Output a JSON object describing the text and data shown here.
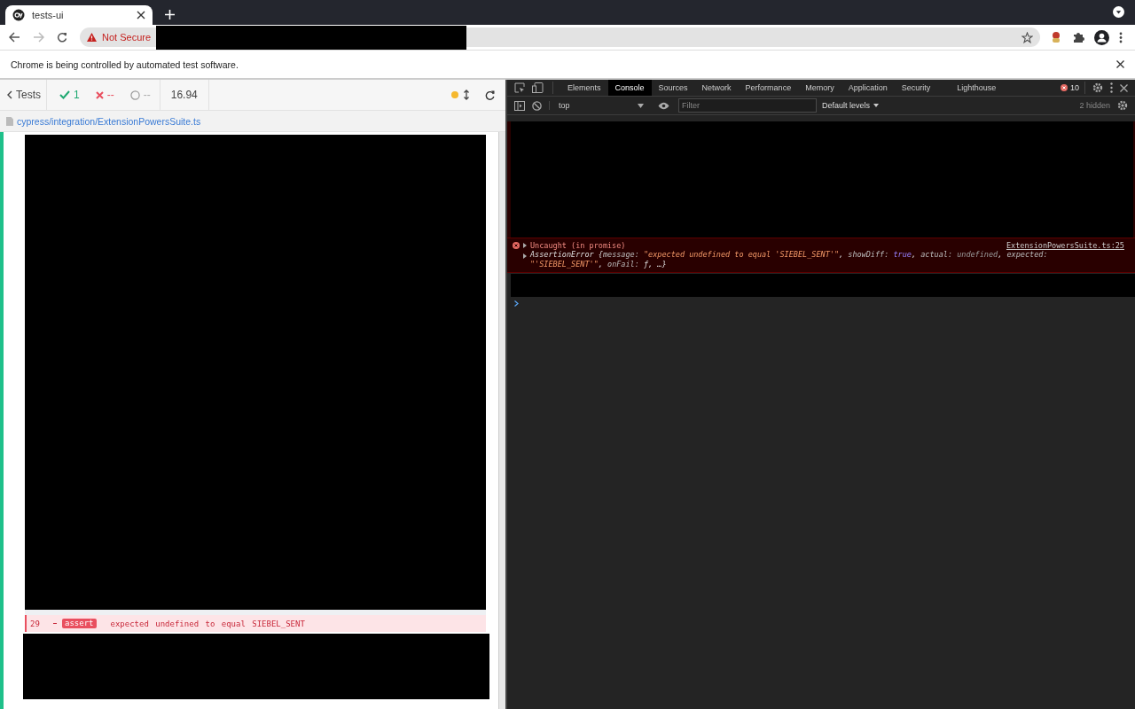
{
  "browser": {
    "tab_title": "tests-ui",
    "url_warning": "Not Secure",
    "infobar": "Chrome is being controlled by automated test software."
  },
  "runner": {
    "back_label": "Tests",
    "passed": "1",
    "failed": "--",
    "pending": "--",
    "duration": "16.94",
    "spec_path": "cypress/integration/ExtensionPowersSuite.ts",
    "command_log": [
      {
        "number": "29",
        "failed": true,
        "label": "assert",
        "message": "expected undefined to equal SIEBEL_SENT"
      }
    ]
  },
  "devtools": {
    "tabs": [
      {
        "label": "Elements",
        "selected": false
      },
      {
        "label": "Console",
        "selected": true
      },
      {
        "label": "Sources",
        "selected": false
      },
      {
        "label": "Network",
        "selected": false
      },
      {
        "label": "Performance",
        "selected": false
      },
      {
        "label": "Memory",
        "selected": false
      },
      {
        "label": "Application",
        "selected": false
      },
      {
        "label": "Security",
        "selected": false
      },
      {
        "label": "Lighthouse",
        "selected": false
      }
    ],
    "error_count": "10",
    "context": "top",
    "filter_placeholder": "Filter",
    "levels": "Default levels",
    "hidden": "2 hidden",
    "messages": [
      {
        "error": true,
        "summary": "Uncaught (in promise)",
        "source": "ExtensionPowersSuite.ts:25",
        "detail": [
          {
            "kind": "plain",
            "text": "AssertionError {"
          },
          {
            "kind": "key",
            "text": "message: "
          },
          {
            "kind": "string",
            "text": "\"expected undefined to equal 'SIEBEL_SENT'\""
          },
          {
            "kind": "plain",
            "text": ", "
          },
          {
            "kind": "key",
            "text": "showDiff: "
          },
          {
            "kind": "keyword",
            "text": "true"
          },
          {
            "kind": "plain",
            "text": ", "
          },
          {
            "kind": "key",
            "text": "actual: "
          },
          {
            "kind": "null",
            "text": "undefined"
          },
          {
            "kind": "plain",
            "text": ", "
          },
          {
            "kind": "key",
            "text": "expected: "
          },
          {
            "kind": "string",
            "text": "\"'SIEBEL_SENT'\""
          },
          {
            "kind": "plain",
            "text": ", "
          },
          {
            "kind": "key",
            "text": "onFail: "
          },
          {
            "kind": "plain",
            "text": "ƒ, …}"
          }
        ]
      }
    ]
  }
}
